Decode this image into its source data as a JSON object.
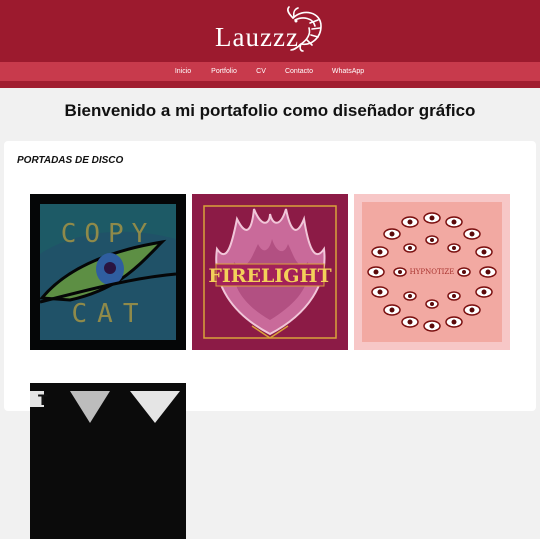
{
  "header": {
    "logo": "Lauzzz"
  },
  "nav": {
    "items": [
      {
        "label": "Inicio"
      },
      {
        "label": "Portfolio"
      },
      {
        "label": "CV"
      },
      {
        "label": "Contacto"
      },
      {
        "label": "WhatsApp"
      }
    ]
  },
  "welcome": {
    "title": "Bienvenido a mi portafolio como diseñador gráfico"
  },
  "portfolio": {
    "section_title": "PORTADAS DE DISCO",
    "albums": [
      {
        "icon": "copy-cat-cover",
        "line1": "COPY",
        "line2": "CAT"
      },
      {
        "icon": "firelight-cover",
        "title": "FIRELIGHT"
      },
      {
        "icon": "hypnotize-cover",
        "title": "HYPNOTIZE"
      },
      {
        "icon": "partial-cover",
        "text": "T"
      }
    ]
  },
  "colors": {
    "header_bg": "#9c1a2e",
    "nav_bg": "#c83a4c",
    "page_bg": "#f1f1f1",
    "card_bg": "#ffffff"
  }
}
